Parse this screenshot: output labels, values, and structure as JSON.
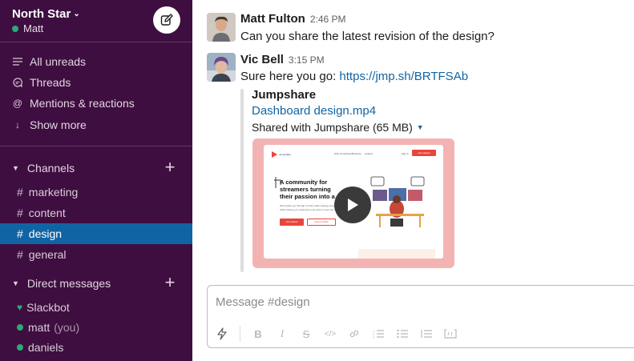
{
  "workspace": {
    "name": "North Star",
    "user": "Matt"
  },
  "nav": [
    {
      "label": "All unreads",
      "icon": "all-unreads-icon"
    },
    {
      "label": "Threads",
      "icon": "threads-icon"
    },
    {
      "label": "Mentions & reactions",
      "icon": "mentions-icon"
    },
    {
      "label": "Show more",
      "icon": "arrow-down-icon"
    }
  ],
  "channels_section": {
    "title": "Channels"
  },
  "channels": [
    {
      "name": "marketing"
    },
    {
      "name": "content"
    },
    {
      "name": "design"
    },
    {
      "name": "general"
    }
  ],
  "dm_section": {
    "title": "Direct messages"
  },
  "dms": [
    {
      "name": "Slackbot",
      "you": ""
    },
    {
      "name": "matt",
      "you": "(you)"
    },
    {
      "name": "daniels",
      "you": ""
    }
  ],
  "messages": [
    {
      "author": "Matt Fulton",
      "time": "2:46 PM",
      "text": "Can you share the latest revision of the design?"
    },
    {
      "author": "Vic Bell",
      "time": "3:15 PM",
      "text": "Sure here you go: ",
      "link": "https://jmp.sh/BRTFSAb"
    }
  ],
  "attachment": {
    "service": "Jumpshare",
    "filename": "Dashboard design.mp4",
    "meta": "Shared with Jumpshare (65 MB)"
  },
  "video_preview": {
    "brand": "Jumpshare",
    "nav1": "Why Jumpshare?",
    "nav2": "Products",
    "nav3": "Upload",
    "nav4": "Sign in",
    "cta": "Get started",
    "headline": "A community for streamers turning their passion into a career",
    "body": "We'll guide you through a hand-made strategy step-by-step, while helping you implement new tools to meet the results.",
    "btn1": "Get started",
    "btn2": "How it works"
  },
  "composer": {
    "placeholder": "Message #design"
  },
  "colors": {
    "sidebar": "#3f0e40",
    "active": "#1164a3",
    "link": "#1264a3",
    "online": "#2bac76",
    "video_bg": "#f4b3b3"
  }
}
